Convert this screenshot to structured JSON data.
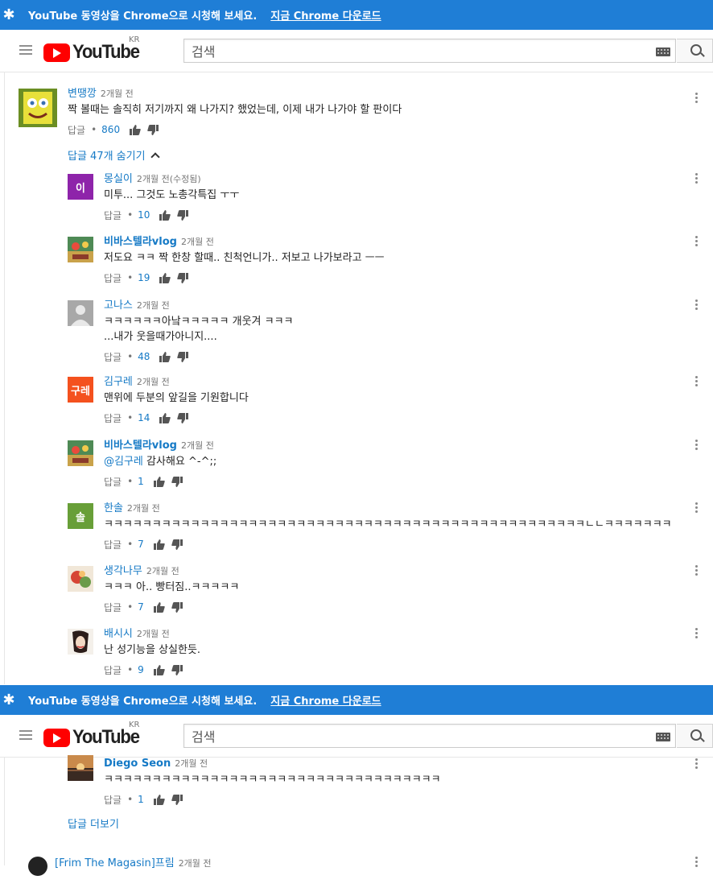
{
  "banner": {
    "text": "YouTube 동영상을 Chrome으로 시청해 보세요.",
    "link": "지금 Chrome 다운로드"
  },
  "header": {
    "logo_text": "YouTube",
    "region": "KR",
    "search_placeholder": "검색"
  },
  "top_comment": {
    "author": "변땡깡",
    "time": "2개월 전",
    "text": "짝 볼때는 솔직히 저기까지 왜 나가지? 했었는데, 이제 내가 나가야 할 판이다",
    "reply_label": "답글",
    "likes": "860",
    "hide_replies": "답글 47개 숨기기"
  },
  "replies": [
    {
      "author": "몽실이",
      "time": "2개월 전(수정됨)",
      "text": "미투... 그것도 노총각특집 ㅜㅜ",
      "reply_label": "답글",
      "likes": "10",
      "avatar_letter": "이",
      "avatar_color": "#8e24aa"
    },
    {
      "author": "비바스텔라vlog",
      "time": "2개월 전",
      "text": "저도요 ㅋㅋ 짝 한창 할때.. 친척언니가.. 저보고 나가보라고 ㅡㅡ",
      "reply_label": "답글",
      "likes": "19"
    },
    {
      "author": "고나스",
      "time": "2개월 전",
      "text": "ㅋㅋㅋㅋㅋㅋ아낰ㅋㅋㅋㅋㅋ 개웃겨 ㅋㅋㅋ\n...내가 웃을때가아니지....",
      "reply_label": "답글",
      "likes": "48"
    },
    {
      "author": "김구레",
      "time": "2개월 전",
      "text": "맨위에 두분의 앞길을 기원합니다",
      "reply_label": "답글",
      "likes": "14",
      "avatar_letter": "구레",
      "avatar_color": "#f4511e"
    },
    {
      "author": "비바스텔라vlog",
      "time": "2개월 전",
      "mention": "@김구레",
      "text": " 감사해요 ^-^;;",
      "reply_label": "답글",
      "likes": "1"
    },
    {
      "author": "한솔",
      "time": "2개월 전",
      "text": "ㅋㅋㅋㅋㅋㅋㅋㅋㅋㅋㅋㅋㅋㅋㅋㅋㅋㅋㅋㅋㅋㅋㅋㅋㅋㅋㅋㅋㅋㅋㅋㅋㅋㅋㅋㅋㅋㅋㅋㅋㅋㅋㅋㅋㅋㅋㅋㅋㅋㅋㄴㄴㅋㅋㅋㅋㅋㅋㅋ",
      "reply_label": "답글",
      "likes": "7",
      "avatar_letter": "솔",
      "avatar_color": "#689f38"
    },
    {
      "author": "생각나무",
      "time": "2개월 전",
      "text": "ㅋㅋㅋ 아.. 빵터짐..ㅋㅋㅋㅋㅋ",
      "reply_label": "답글",
      "likes": "7"
    },
    {
      "author": "배시시",
      "time": "2개월 전",
      "text": "난 성기능을 상실한듯.",
      "reply_label": "답글",
      "likes": "9"
    }
  ],
  "lower": {
    "reply": {
      "author": "Diego Seon",
      "time": "2개월 전",
      "text": "ㅋㅋㅋㅋㅋㅋㅋㅋㅋㅋㅋㅋㅋㅋㅋㅋㅋㅋㅋㅋㅋㅋㅋㅋㅋㅋㅋㅋㅋㅋㅋㅋㅋㅋㅋ",
      "reply_label": "답글",
      "likes": "1"
    },
    "more_replies": "답글 더보기",
    "next_comment": {
      "author": "[Frim The Magasin]프림",
      "time": "2개월 전"
    }
  }
}
